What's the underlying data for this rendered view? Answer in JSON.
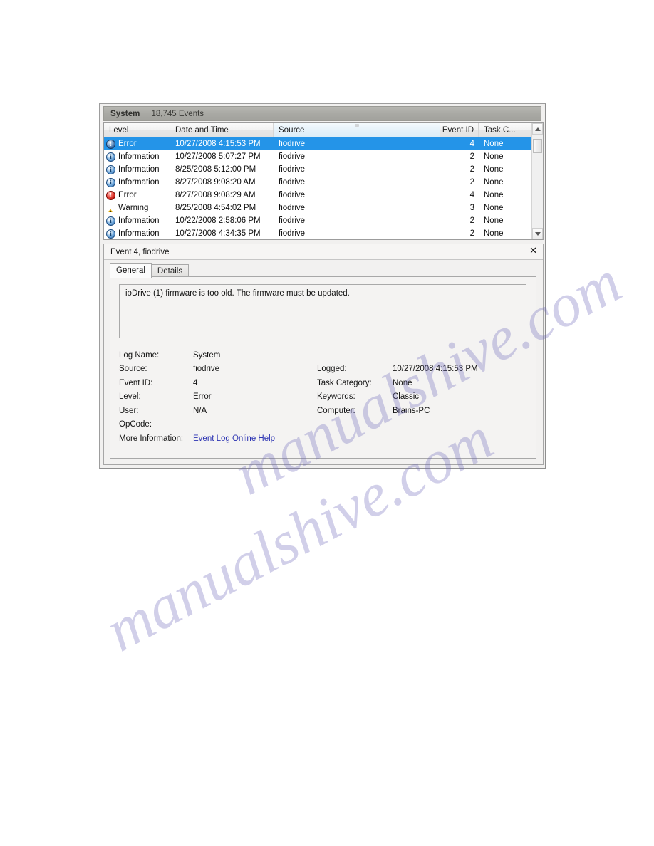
{
  "window": {
    "log_header": {
      "log_name": "System",
      "event_count": "18,745 Events"
    },
    "columns": [
      {
        "key": "level",
        "label": "Level"
      },
      {
        "key": "date",
        "label": "Date and Time"
      },
      {
        "key": "source",
        "label": "Source"
      },
      {
        "key": "eventid",
        "label": "Event ID"
      },
      {
        "key": "taskcat",
        "label": "Task C..."
      }
    ],
    "sorted_column": "Source",
    "rows": [
      {
        "level": "Error",
        "icon": "error-icon",
        "date": "10/27/2008 4:15:53 PM",
        "source": "fiodrive",
        "eventid": "4",
        "taskcat": "None",
        "selected": true
      },
      {
        "level": "Information",
        "icon": "information-icon",
        "date": "10/27/2008 5:07:27 PM",
        "source": "fiodrive",
        "eventid": "2",
        "taskcat": "None",
        "selected": false
      },
      {
        "level": "Information",
        "icon": "information-icon",
        "date": "8/25/2008 5:12:00 PM",
        "source": "fiodrive",
        "eventid": "2",
        "taskcat": "None",
        "selected": false
      },
      {
        "level": "Information",
        "icon": "information-icon",
        "date": "8/27/2008 9:08:20 AM",
        "source": "fiodrive",
        "eventid": "2",
        "taskcat": "None",
        "selected": false
      },
      {
        "level": "Error",
        "icon": "error-icon",
        "date": "8/27/2008 9:08:29 AM",
        "source": "fiodrive",
        "eventid": "4",
        "taskcat": "None",
        "selected": false
      },
      {
        "level": "Warning",
        "icon": "warning-icon",
        "date": "8/25/2008 4:54:02 PM",
        "source": "fiodrive",
        "eventid": "3",
        "taskcat": "None",
        "selected": false
      },
      {
        "level": "Information",
        "icon": "information-icon",
        "date": "10/22/2008 2:58:06 PM",
        "source": "fiodrive",
        "eventid": "2",
        "taskcat": "None",
        "selected": false
      },
      {
        "level": "Information",
        "icon": "information-icon",
        "date": "10/27/2008 4:34:35 PM",
        "source": "fiodrive",
        "eventid": "2",
        "taskcat": "None",
        "selected": false
      }
    ],
    "detail": {
      "title": "Event 4, fiodrive",
      "close_label": "✕",
      "tabs": [
        {
          "label": "General",
          "active": true
        },
        {
          "label": "Details",
          "active": false
        }
      ],
      "message": "ioDrive (1) firmware is too old. The firmware must be updated.",
      "properties": [
        {
          "label": "Log Name:",
          "value": "System",
          "label2": "",
          "value2": ""
        },
        {
          "label": "Source:",
          "value": "fiodrive",
          "label2": "Logged:",
          "value2": "10/27/2008 4:15:53 PM"
        },
        {
          "label": "Event ID:",
          "value": "4",
          "label2": "Task Category:",
          "value2": "None"
        },
        {
          "label": "Level:",
          "value": "Error",
          "label2": "Keywords:",
          "value2": "Classic"
        },
        {
          "label": "User:",
          "value": "N/A",
          "label2": "Computer:",
          "value2": "Brains-PC"
        },
        {
          "label": "OpCode:",
          "value": "",
          "label2": "",
          "value2": ""
        }
      ],
      "more_info_label": "More Information:",
      "more_info_link": "Event Log Online Help"
    }
  },
  "watermark": {
    "line_a": "manualshive.com",
    "line_b": "manualshive.com"
  },
  "colors": {
    "selection_blue": "#2494e8",
    "link_blue": "#2b32b2",
    "error_red": "#cc1f16",
    "warning_yellow": "#d9a400",
    "info_blue": "#2b5f9c",
    "header_gray": "#a9a9a4"
  }
}
